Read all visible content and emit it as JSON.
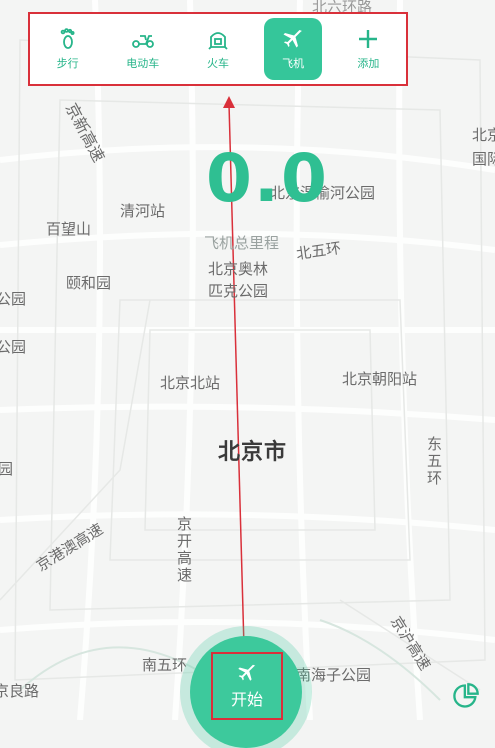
{
  "modes": [
    {
      "label": "步行",
      "icon": "footprint-icon"
    },
    {
      "label": "电动车",
      "icon": "scooter-icon"
    },
    {
      "label": "火车",
      "icon": "train-icon"
    },
    {
      "label": "飞机",
      "icon": "airplane-icon",
      "active": true
    },
    {
      "label": "添加",
      "icon": "plus-icon"
    }
  ],
  "stat": {
    "value": "0.0",
    "label": "飞机总里程"
  },
  "start": {
    "label": "开始",
    "icon": "airplane-icon"
  },
  "map_labels": {
    "l1": "北六环路",
    "l2": "京新高速",
    "l3": "北京",
    "l4": "国际",
    "l5": "北京温榆河公园",
    "l6": "百望山",
    "l7": "清河站",
    "l8": "北五环",
    "l9": "北京奥林",
    "l10": "匹克公园",
    "l11": "颐和园",
    "l12": "公园",
    "l13": "公园",
    "l14": "北京北站",
    "l15": "北京朝阳站",
    "l16": "北京市",
    "l17": "东五环",
    "l18": "园",
    "l19": "京港澳高速",
    "l20": "京开高速",
    "l21": "南五环",
    "l22": "南海子公园",
    "l23": "京沪高速",
    "l24": "京良路"
  },
  "colors": {
    "accent": "#35c69a",
    "annotation": "#d9303a"
  }
}
